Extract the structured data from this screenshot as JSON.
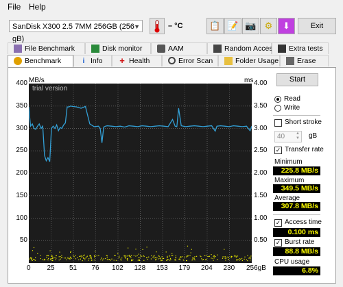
{
  "menu": {
    "file": "File",
    "help": "Help"
  },
  "toolbar": {
    "drive": "SanDisk X300 2.5 7MM 256GB (256 gB)",
    "temperature": "– °C",
    "exit": "Exit"
  },
  "tabs_top": [
    "File Benchmark",
    "Disk monitor",
    "AAM",
    "Random Access",
    "Extra tests"
  ],
  "tabs_bottom": [
    "Benchmark",
    "Info",
    "Health",
    "Error Scan",
    "Folder Usage",
    "Erase"
  ],
  "chart": {
    "watermark": "trial version",
    "left_unit": "MB/s",
    "right_unit": "ms",
    "left_ticks": [
      "400",
      "350",
      "300",
      "250",
      "200",
      "150",
      "100",
      "50"
    ],
    "right_ticks": [
      "4.00",
      "3.50",
      "3.00",
      "2.50",
      "2.00",
      "1.50",
      "1.00",
      "0.50"
    ],
    "x_ticks": [
      "0",
      "25",
      "51",
      "76",
      "102",
      "128",
      "153",
      "179",
      "204",
      "230",
      "256gB"
    ]
  },
  "chart_data": {
    "type": "line",
    "xlabel": "",
    "ylabel": "MB/s",
    "y2label": "ms",
    "xlim": [
      0,
      256
    ],
    "ylim": [
      0,
      400
    ],
    "y2lim": [
      0,
      4.0
    ],
    "series": [
      {
        "x": [
          0,
          2,
          4,
          6,
          8,
          10,
          12,
          14,
          16,
          18,
          20,
          22,
          24,
          26,
          28,
          30,
          32,
          34,
          36,
          38,
          40,
          42,
          44,
          46,
          48,
          50,
          55,
          60,
          65,
          70,
          75,
          80,
          82,
          84,
          86,
          88,
          90,
          95,
          100,
          105,
          110,
          115,
          120,
          125,
          130,
          135,
          140,
          145,
          150,
          155,
          160,
          165,
          168,
          170,
          172,
          175,
          180,
          185,
          190,
          195,
          200,
          205,
          210,
          212,
          214,
          216,
          220,
          225,
          230,
          235,
          240,
          245,
          250,
          252,
          254,
          256
        ],
        "values": [
          348,
          305,
          310,
          300,
          298,
          305,
          310,
          300,
          305,
          240,
          228,
          235,
          226,
          300,
          305,
          300,
          308,
          295,
          302,
          300,
          308,
          312,
          348,
          348,
          350,
          349,
          348,
          345,
          349,
          310,
          304,
          305,
          300,
          268,
          303,
          305,
          306,
          305,
          304,
          305,
          303,
          306,
          305,
          304,
          306,
          305,
          304,
          305,
          306,
          305,
          304,
          320,
          305,
          304,
          345,
          306,
          304,
          305,
          306,
          305,
          304,
          305,
          306,
          300,
          294,
          305,
          306,
          305,
          304,
          306,
          305,
          304,
          305,
          300,
          295,
          305
        ]
      }
    ]
  },
  "controls": {
    "start": "Start",
    "read": "Read",
    "write": "Write",
    "short_stroke": "Short stroke",
    "stroke_value": "40",
    "stroke_unit": "gB",
    "transfer_rate": "Transfer rate",
    "minimum_label": "Minimum",
    "minimum": "225.8 MB/s",
    "maximum_label": "Maximum",
    "maximum": "349.5 MB/s",
    "average_label": "Average",
    "average": "307.8 MB/s",
    "access_time": "Access time",
    "access_value": "0.100 ms",
    "burst_rate": "Burst rate",
    "burst_value": "88.8 MB/s",
    "cpu_label": "CPU usage",
    "cpu_value": "6.8%"
  },
  "colors": {
    "plot_bg": "#1c1c1c",
    "line": "#33a0d6",
    "dots": "#e8e800",
    "stat_bg": "#000000",
    "stat_fg": "#ffff00"
  }
}
